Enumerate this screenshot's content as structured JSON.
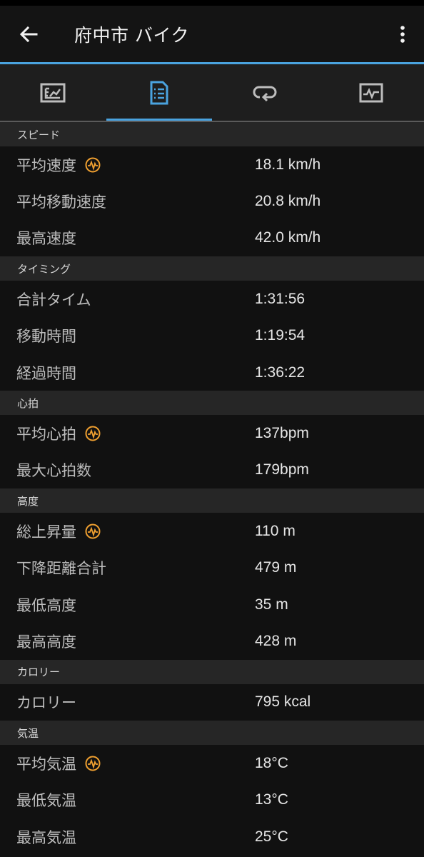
{
  "header": {
    "title": "府中市 バイク"
  },
  "colors": {
    "accent": "#4aa3df",
    "hr_icon": "#f0a030"
  },
  "tabs": [
    {
      "icon": "summary-chart-icon",
      "active": false
    },
    {
      "icon": "stats-document-icon",
      "active": true
    },
    {
      "icon": "laps-loop-icon",
      "active": false
    },
    {
      "icon": "graphs-pulse-icon",
      "active": false
    }
  ],
  "sections": {
    "speed": {
      "title": "スピード",
      "avg_speed": {
        "label": "平均速度",
        "value": "18.1 km/h"
      },
      "avg_moving_speed": {
        "label": "平均移動速度",
        "value": "20.8 km/h"
      },
      "max_speed": {
        "label": "最高速度",
        "value": "42.0 km/h"
      }
    },
    "timing": {
      "title": "タイミング",
      "total_time": {
        "label": "合計タイム",
        "value": "1:31:56"
      },
      "moving_time": {
        "label": "移動時間",
        "value": "1:19:54"
      },
      "elapsed_time": {
        "label": "経過時間",
        "value": "1:36:22"
      }
    },
    "heart_rate": {
      "title": "心拍",
      "avg_hr": {
        "label": "平均心拍",
        "value": "137bpm"
      },
      "max_hr": {
        "label": "最大心拍数",
        "value": "179bpm"
      }
    },
    "elevation": {
      "title": "高度",
      "total_ascent": {
        "label": "総上昇量",
        "value": "110 m"
      },
      "total_descent": {
        "label": "下降距離合計",
        "value": "479 m"
      },
      "min_elevation": {
        "label": "最低高度",
        "value": "35 m"
      },
      "max_elevation": {
        "label": "最高高度",
        "value": "428 m"
      }
    },
    "calories": {
      "title": "カロリー",
      "calories": {
        "label": "カロリー",
        "value": "795 kcal"
      }
    },
    "temperature": {
      "title": "気温",
      "avg_temp": {
        "label": "平均気温",
        "value": "18°C"
      },
      "min_temp": {
        "label": "最低気温",
        "value": "13°C"
      },
      "max_temp": {
        "label": "最高気温",
        "value": "25°C"
      }
    }
  }
}
